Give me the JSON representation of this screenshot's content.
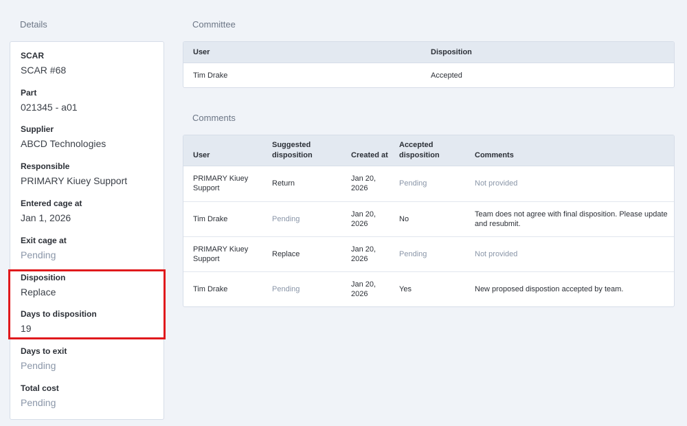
{
  "details": {
    "title": "Details",
    "fields": [
      {
        "label": "SCAR",
        "value": "SCAR #68"
      },
      {
        "label": "Part",
        "value": "021345 - a01"
      },
      {
        "label": "Supplier",
        "value": "ABCD Technologies"
      },
      {
        "label": "Responsible",
        "value": "PRIMARY Kiuey Support"
      },
      {
        "label": "Entered cage at",
        "value": "Jan 1, 2026"
      },
      {
        "label": "Exit cage at",
        "value": "Pending"
      },
      {
        "label": "Disposition",
        "value": "Replace"
      },
      {
        "label": "Days to disposition",
        "value": "19"
      },
      {
        "label": "Days to exit",
        "value": "Pending"
      },
      {
        "label": "Total cost",
        "value": "Pending"
      }
    ]
  },
  "committee": {
    "title": "Committee",
    "headers": {
      "user": "User",
      "disposition": "Disposition"
    },
    "rows": [
      {
        "user": "Tim Drake",
        "disposition": "Accepted"
      }
    ]
  },
  "comments": {
    "title": "Comments",
    "headers": {
      "user": "User",
      "suggested_line1": "Suggested",
      "suggested_line2": "disposition",
      "created": "Created at",
      "accepted_line1": "Accepted",
      "accepted_line2": "disposition",
      "comments": "Comments"
    },
    "rows": [
      {
        "user_line1": "PRIMARY Kiuey",
        "user_line2": "Support",
        "suggested": "Return",
        "created_line1": "Jan 20,",
        "created_line2": "2026",
        "accepted": "Pending",
        "comment_line1": "Not provided",
        "comment_line2": ""
      },
      {
        "user_line1": "Tim Drake",
        "user_line2": "",
        "suggested": "Pending",
        "created_line1": "Jan 20,",
        "created_line2": "2026",
        "accepted": "No",
        "comment_line1": "Team does not agree with final disposition. Please update",
        "comment_line2": "and resubmit."
      },
      {
        "user_line1": "PRIMARY Kiuey",
        "user_line2": "Support",
        "suggested": "Replace",
        "created_line1": "Jan 20,",
        "created_line2": "2026",
        "accepted": "Pending",
        "comment_line1": "Not provided",
        "comment_line2": ""
      },
      {
        "user_line1": "Tim Drake",
        "user_line2": "",
        "suggested": "Pending",
        "created_line1": "Jan 20,",
        "created_line2": "2026",
        "accepted": "Yes",
        "comment_line1": "New proposed dispostion accepted by team.",
        "comment_line2": ""
      }
    ]
  },
  "colors": {
    "background": "#f0f3f8",
    "muted_text": "#8a96a8",
    "table_header": "#e3e9f1",
    "highlight": "#e0191c"
  }
}
